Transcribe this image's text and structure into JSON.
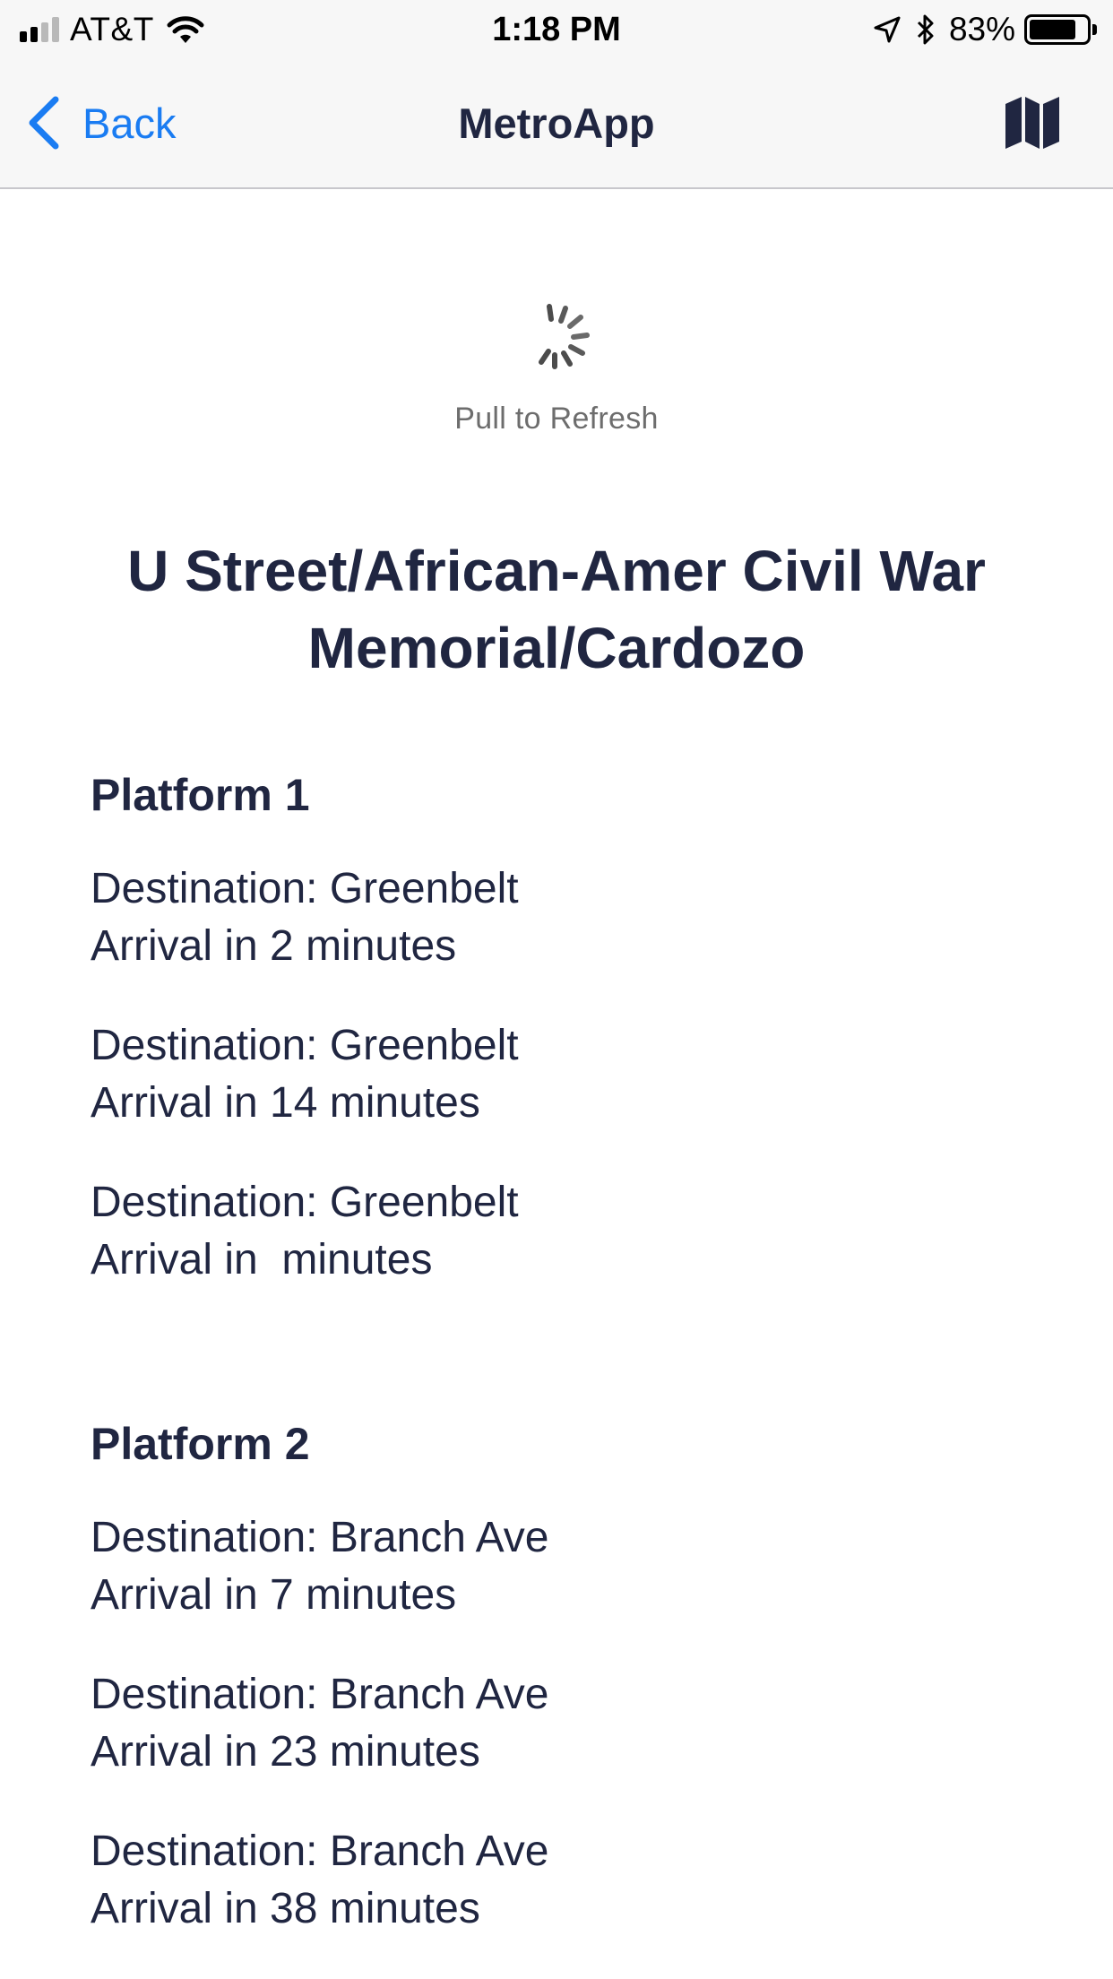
{
  "status_bar": {
    "carrier": "AT&T",
    "time": "1:18 PM",
    "battery_percent_text": "83%",
    "battery_level": 0.83,
    "signal_bars_filled": 2,
    "signal_bars_total": 4
  },
  "nav": {
    "back_label": "Back",
    "title": "MetroApp",
    "right_icon": "map-icon",
    "accent_color": "#1a7cf2"
  },
  "refresh": {
    "label": "Pull to Refresh"
  },
  "station": {
    "name": "U Street/African-Amer Civil War Memorial/Cardozo"
  },
  "platforms": [
    {
      "title": "Platform 1",
      "arrivals": [
        {
          "destination": "Destination: Greenbelt",
          "arrival": "Arrival in 2 minutes"
        },
        {
          "destination": "Destination: Greenbelt",
          "arrival": "Arrival in 14 minutes"
        },
        {
          "destination": "Destination: Greenbelt",
          "arrival": "Arrival in  minutes"
        }
      ]
    },
    {
      "title": "Platform 2",
      "arrivals": [
        {
          "destination": "Destination: Branch Ave",
          "arrival": "Arrival in 7 minutes"
        },
        {
          "destination": "Destination: Branch Ave",
          "arrival": "Arrival in 23 minutes"
        },
        {
          "destination": "Destination: Branch Ave",
          "arrival": "Arrival in 38 minutes"
        }
      ]
    }
  ]
}
